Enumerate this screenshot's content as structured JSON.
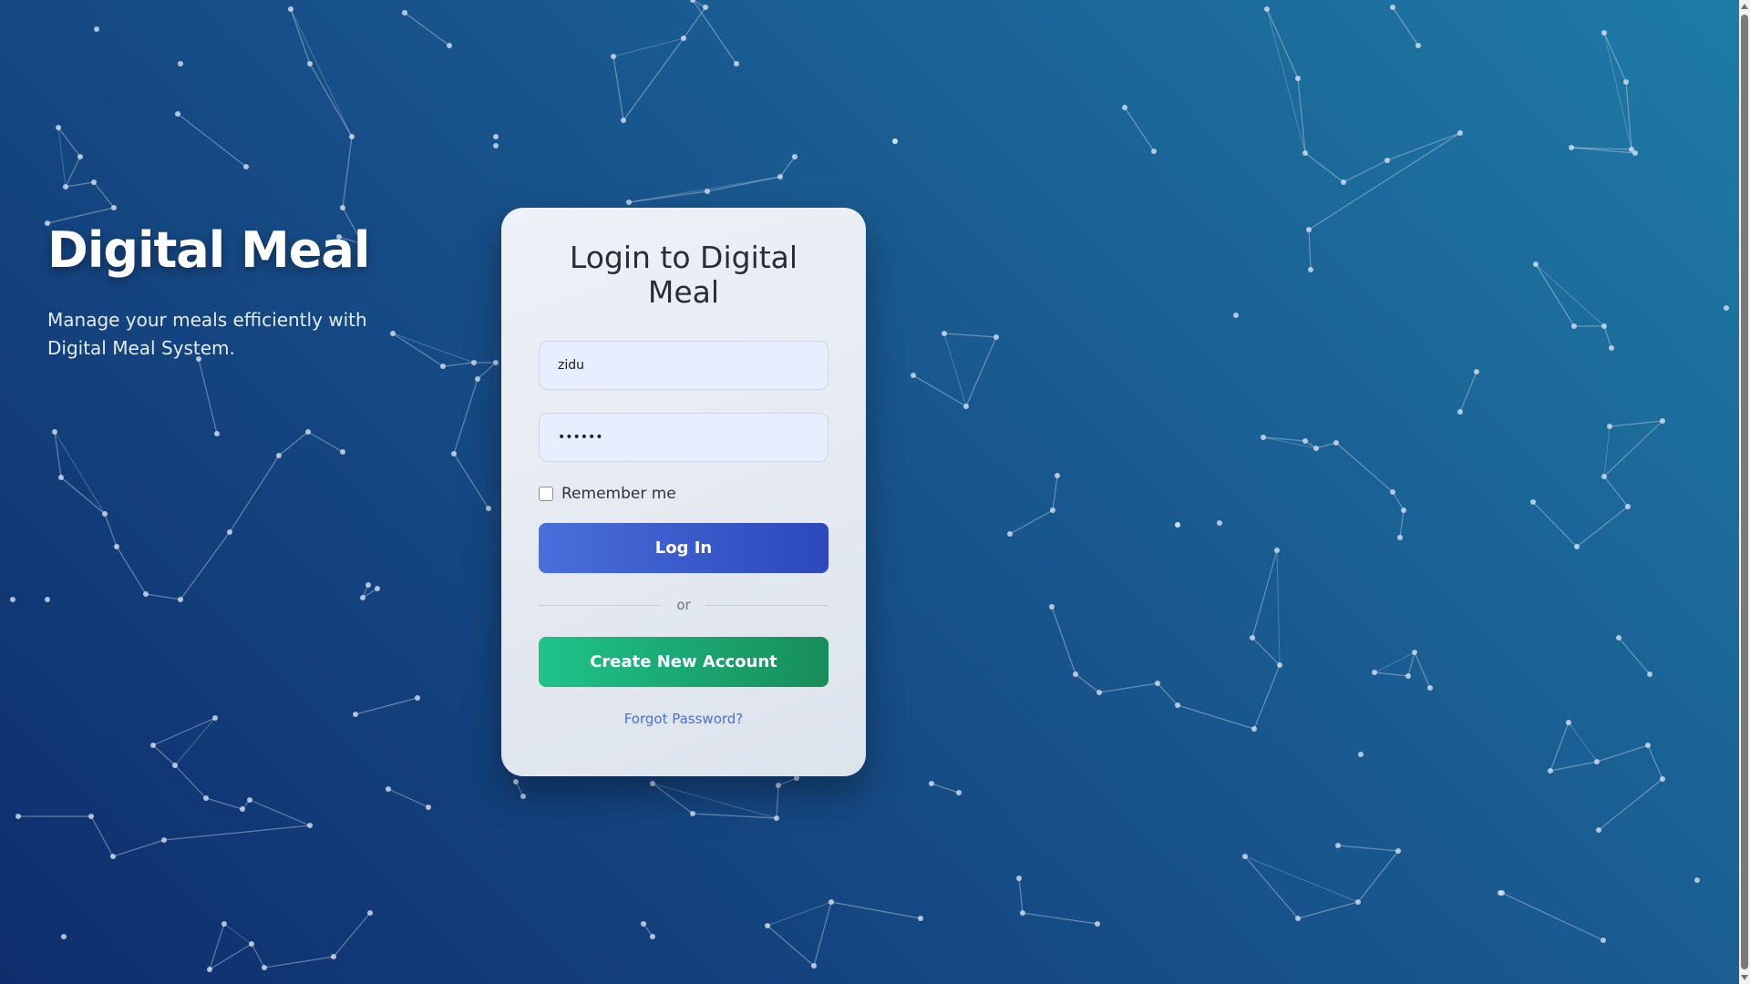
{
  "hero": {
    "title": "Digital Meal",
    "tagline": "Manage your meals efficiently with Digital Meal System."
  },
  "login_card": {
    "title": "Login to Digital Meal",
    "username": {
      "value": "zidu"
    },
    "password": {
      "value": "••••••"
    },
    "remember_label": "Remember me",
    "remember_checked": false,
    "login_label": "Log In",
    "divider_text": "or",
    "create_label": "Create New Account",
    "forgot_label": "Forgot Password?"
  },
  "colors": {
    "background_start": "#0e2d6c",
    "background_end": "#1f7ba6",
    "login_button": "#3a5ccf",
    "create_button": "#1aa874",
    "link": "#4b6fd1"
  }
}
